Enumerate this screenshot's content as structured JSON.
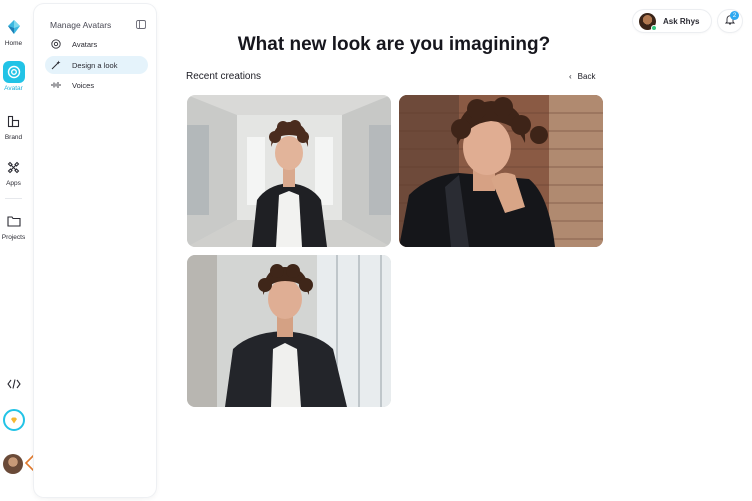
{
  "rail": {
    "items": [
      {
        "label": "Home",
        "icon": "app-logo-icon"
      },
      {
        "label": "Avatar",
        "icon": "avatar-icon",
        "active": true
      },
      {
        "label": "Brand",
        "icon": "brand-icon"
      },
      {
        "label": "Apps",
        "icon": "apps-icon"
      },
      {
        "label": "Projects",
        "icon": "folder-icon"
      }
    ],
    "code_icon": "code-icon",
    "premium_icon": "diamond-icon"
  },
  "panel": {
    "title": "Manage Avatars",
    "items": [
      {
        "label": "Avatars",
        "icon": "avatar-circle-icon"
      },
      {
        "label": "Design a look",
        "icon": "magic-wand-icon",
        "active": true
      },
      {
        "label": "Voices",
        "icon": "waveform-icon"
      }
    ]
  },
  "header": {
    "ask_label": "Ask Rhys",
    "notification_count": "2"
  },
  "main": {
    "title": "What new look are you imagining?",
    "section_title": "Recent creations",
    "back_label": "Back"
  },
  "gallery": [
    {
      "name": "creation-1",
      "scene": "white corridor, dark blazer, white t-shirt"
    },
    {
      "name": "creation-2",
      "scene": "brick wall, leather jacket, hand on chin"
    },
    {
      "name": "creation-3",
      "scene": "window background, dark blazer, white t-shirt"
    }
  ],
  "colors": {
    "accent": "#22c3e6",
    "active_panel_bg": "#e5f3fb",
    "badge": "#2da8f0",
    "logo_orange": "#e07a2e"
  }
}
